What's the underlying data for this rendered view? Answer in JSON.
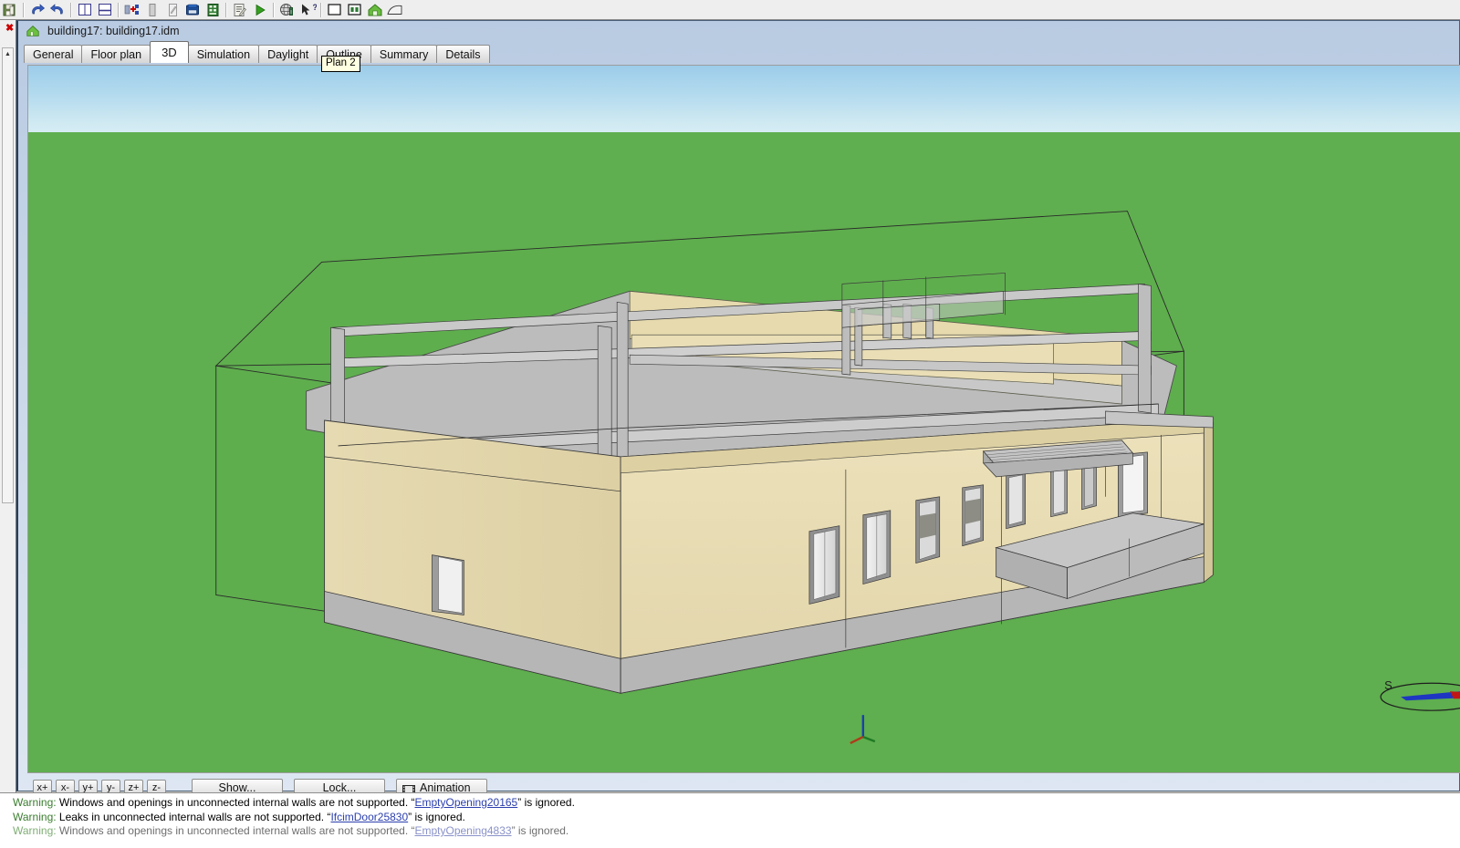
{
  "toolbar": {
    "icons": [
      {
        "name": "save-icon",
        "glyph": "save"
      },
      {
        "name": "undo-icon",
        "glyph": "undo"
      },
      {
        "name": "redo-icon",
        "glyph": "redo"
      },
      {
        "name": "tile-vertical-icon",
        "glyph": "tile-v"
      },
      {
        "name": "tile-horizontal-icon",
        "glyph": "tile-h"
      },
      {
        "name": "insert-object-icon",
        "glyph": "insert"
      },
      {
        "name": "delete-object-icon",
        "glyph": "blank-doc"
      },
      {
        "name": "edit-properties-icon",
        "glyph": "pencil-doc"
      },
      {
        "name": "database-icon",
        "glyph": "db-blue"
      },
      {
        "name": "resources-icon",
        "glyph": "db-green"
      },
      {
        "name": "report-icon",
        "glyph": "report"
      },
      {
        "name": "run-simulation-icon",
        "glyph": "play"
      },
      {
        "name": "web-info-icon",
        "glyph": "globe"
      },
      {
        "name": "context-help-icon",
        "glyph": "help-arrow"
      },
      {
        "name": "new-window-icon",
        "glyph": "window"
      },
      {
        "name": "zone-icon",
        "glyph": "zone"
      },
      {
        "name": "building-icon",
        "glyph": "house-green"
      },
      {
        "name": "shading-icon",
        "glyph": "shading"
      }
    ]
  },
  "window": {
    "title": "building17: building17.idm",
    "icon": "house-green-icon"
  },
  "tabs": [
    {
      "label": "General",
      "active": false,
      "name": "tab-general"
    },
    {
      "label": "Floor plan",
      "active": false,
      "name": "tab-floor-plan"
    },
    {
      "label": "3D",
      "active": true,
      "name": "tab-3d"
    },
    {
      "label": "Simulation",
      "active": false,
      "name": "tab-simulation"
    },
    {
      "label": "Daylight",
      "active": false,
      "name": "tab-daylight"
    },
    {
      "label": "Outline",
      "active": false,
      "name": "tab-outline"
    },
    {
      "label": "Summary",
      "active": false,
      "name": "tab-summary"
    },
    {
      "label": "Details",
      "active": false,
      "name": "tab-details"
    }
  ],
  "tooltip": {
    "text": "Plan 2"
  },
  "viewport": {
    "sky_top_color": "#9cccea",
    "sky_horizon_color": "#d6ecf4",
    "ground_color": "#5fae4f",
    "wall_color": "#e8dcb4",
    "roof_color": "#b8b8b8",
    "base_color": "#b4b4b4",
    "glass_color": "#cfcfcf",
    "compass_label_south": "S"
  },
  "buttonbar": {
    "axis_buttons": [
      {
        "label": "x+",
        "name": "view-x-plus-button"
      },
      {
        "label": "x-",
        "name": "view-x-minus-button"
      },
      {
        "label": "y+",
        "name": "view-y-plus-button"
      },
      {
        "label": "y-",
        "name": "view-y-minus-button"
      },
      {
        "label": "z+",
        "name": "view-z-plus-button"
      },
      {
        "label": "z-",
        "name": "view-z-minus-button"
      }
    ],
    "show_label": "Show...",
    "lock_label": "Lock...",
    "animation_label": "Animation"
  },
  "messages": [
    {
      "level": "Warning:",
      "pre": " Windows and openings in unconnected internal walls are not supported. “",
      "link": "EmptyOpening20165",
      "post": "” is ignored.",
      "clipped": false
    },
    {
      "level": "Warning:",
      "pre": " Leaks in unconnected internal walls are not supported. “",
      "link": "IfcimDoor25830",
      "post": "” is ignored.",
      "clipped": false
    },
    {
      "level": "Warning:",
      "pre": " Windows and openings in unconnected internal walls are not supported. “",
      "link": "EmptyOpening4833",
      "post": "” is ignored.",
      "clipped": true
    }
  ]
}
